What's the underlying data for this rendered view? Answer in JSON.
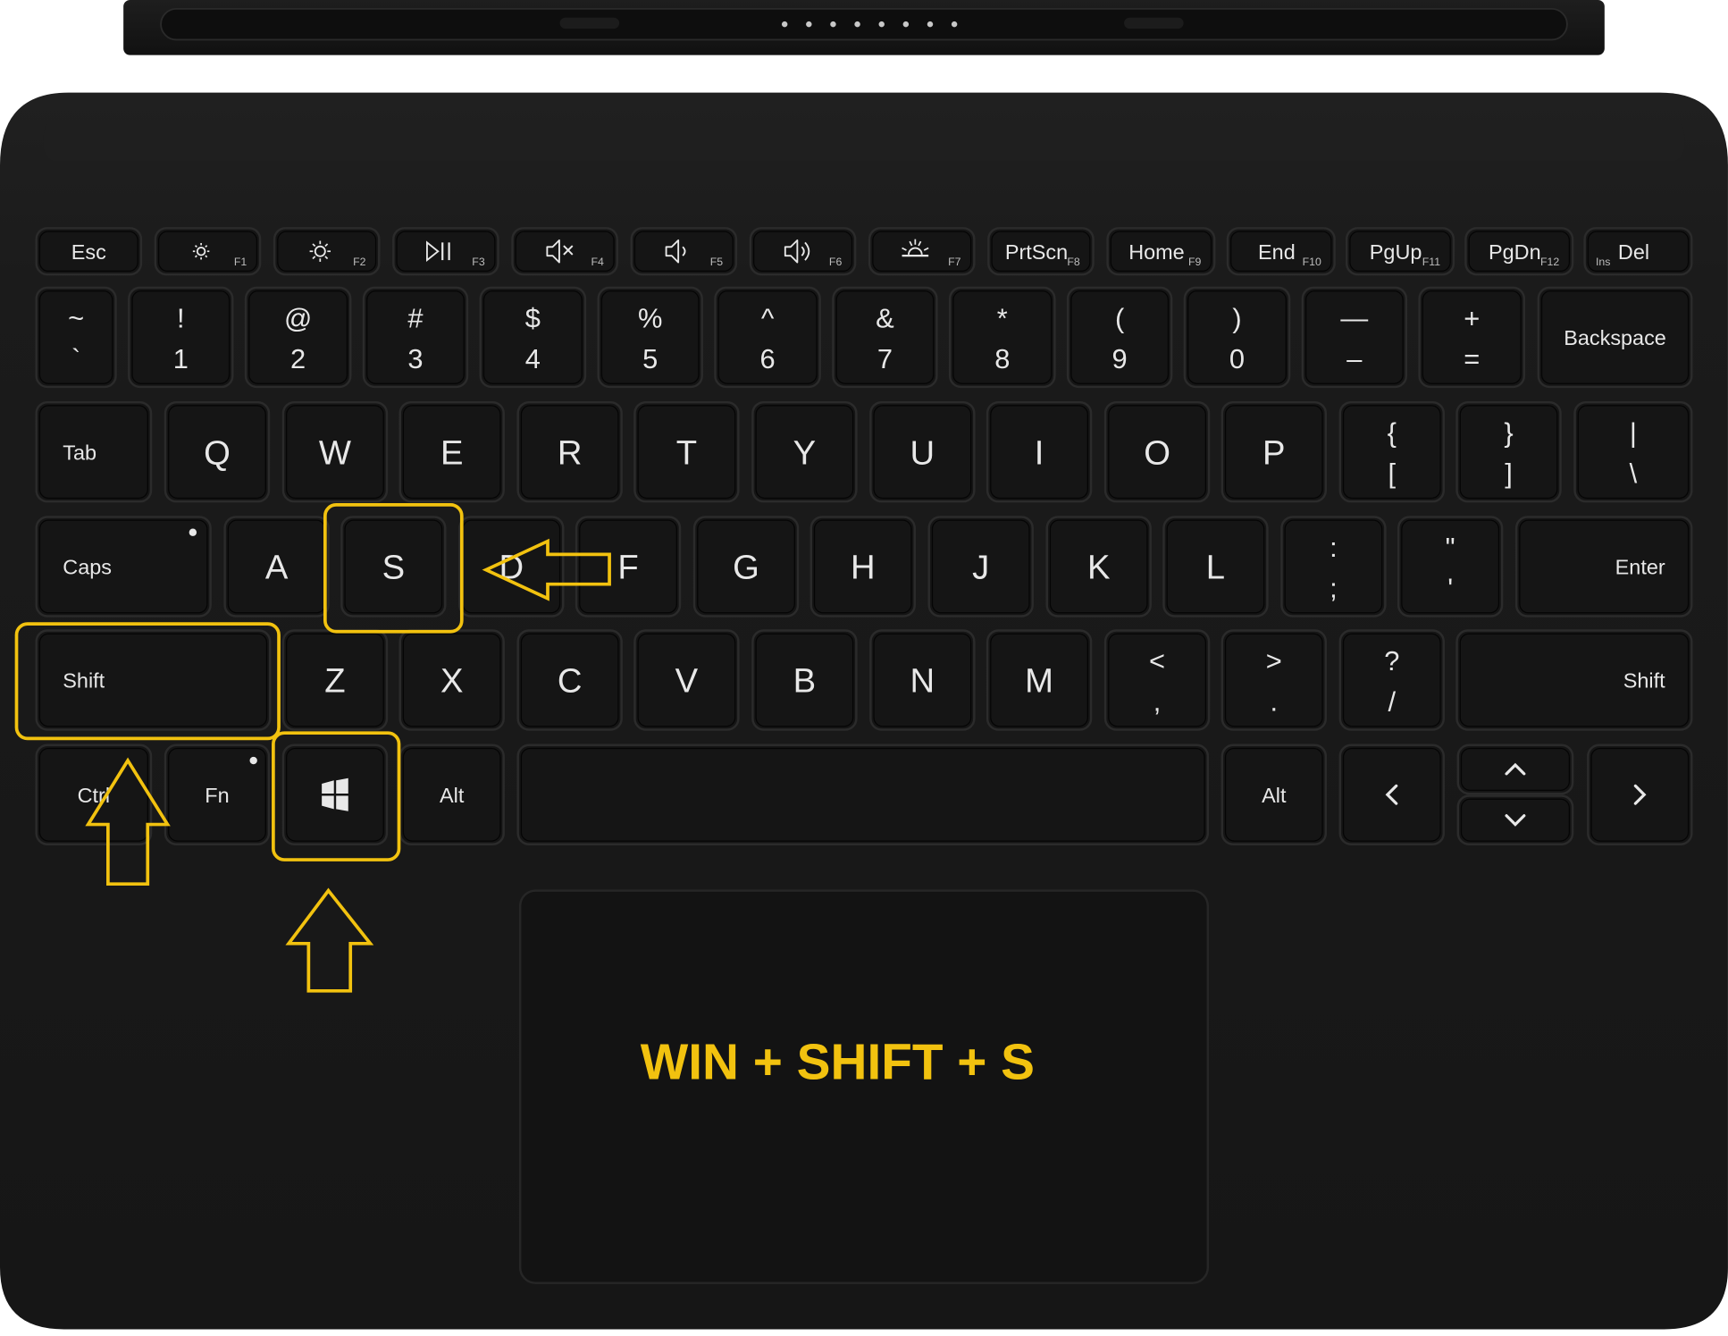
{
  "caption": "WIN + SHIFT + S",
  "colors": {
    "highlight": "#f2c20f",
    "keyboard_body": "#1a1a1a",
    "key_cap": "#151515",
    "key_label": "#e8e8e8"
  },
  "function_row": [
    {
      "label": "Esc",
      "sub": ""
    },
    {
      "icon": "brightness-down-icon",
      "sub": "F1"
    },
    {
      "icon": "brightness-up-icon",
      "sub": "F2"
    },
    {
      "icon": "play-pause-icon",
      "sub": "F3"
    },
    {
      "icon": "mute-icon",
      "sub": "F4"
    },
    {
      "icon": "volume-down-icon",
      "sub": "F5"
    },
    {
      "icon": "volume-up-icon",
      "sub": "F6"
    },
    {
      "icon": "keyboard-backlight-icon",
      "sub": "F7"
    },
    {
      "label": "PrtScn",
      "sub": "F8"
    },
    {
      "label": "Home",
      "sub": "F9"
    },
    {
      "label": "End",
      "sub": "F10"
    },
    {
      "label": "PgUp",
      "sub": "F11"
    },
    {
      "label": "PgDn",
      "sub": "F12"
    },
    {
      "label": "Del",
      "sub": "Ins"
    }
  ],
  "number_row": [
    {
      "top": "~",
      "bottom": "`"
    },
    {
      "top": "!",
      "bottom": "1"
    },
    {
      "top": "@",
      "bottom": "2"
    },
    {
      "top": "#",
      "bottom": "3"
    },
    {
      "top": "$",
      "bottom": "4"
    },
    {
      "top": "%",
      "bottom": "5"
    },
    {
      "top": "^",
      "bottom": "6"
    },
    {
      "top": "&",
      "bottom": "7"
    },
    {
      "top": "*",
      "bottom": "8"
    },
    {
      "top": "(",
      "bottom": "9"
    },
    {
      "top": ")",
      "bottom": "0"
    },
    {
      "top": "—",
      "bottom": "–"
    },
    {
      "top": "+",
      "bottom": "="
    },
    {
      "label": "Backspace"
    }
  ],
  "qwerty_row": [
    {
      "label": "Tab"
    },
    {
      "big": "Q"
    },
    {
      "big": "W"
    },
    {
      "big": "E"
    },
    {
      "big": "R"
    },
    {
      "big": "T"
    },
    {
      "big": "Y"
    },
    {
      "big": "U"
    },
    {
      "big": "I"
    },
    {
      "big": "O"
    },
    {
      "big": "P"
    },
    {
      "top": "{",
      "bottom": "["
    },
    {
      "top": "}",
      "bottom": "]"
    },
    {
      "top": "|",
      "bottom": "\\"
    }
  ],
  "home_row": [
    {
      "label": "Caps"
    },
    {
      "big": "A"
    },
    {
      "big": "S"
    },
    {
      "big": "D"
    },
    {
      "big": "F"
    },
    {
      "big": "G"
    },
    {
      "big": "H"
    },
    {
      "big": "J"
    },
    {
      "big": "K"
    },
    {
      "big": "L"
    },
    {
      "top": ":",
      "bottom": ";"
    },
    {
      "top": "\"",
      "bottom": "'"
    },
    {
      "label": "Enter"
    }
  ],
  "shift_row": [
    {
      "label": "Shift"
    },
    {
      "big": "Z"
    },
    {
      "big": "X"
    },
    {
      "big": "C"
    },
    {
      "big": "V"
    },
    {
      "big": "B"
    },
    {
      "big": "N"
    },
    {
      "big": "M"
    },
    {
      "top": "<",
      "bottom": ","
    },
    {
      "top": ">",
      "bottom": "."
    },
    {
      "top": "?",
      "bottom": "/"
    },
    {
      "label": "Shift"
    }
  ],
  "bottom_row": [
    {
      "label": "Ctrl"
    },
    {
      "label": "Fn"
    },
    {
      "icon": "windows-logo-icon"
    },
    {
      "label": "Alt"
    },
    {
      "label": ""
    },
    {
      "label": "Alt"
    },
    {
      "icon": "arrow-left-icon"
    },
    {
      "icon": "arrow-up-icon"
    },
    {
      "icon": "arrow-down-icon"
    },
    {
      "icon": "arrow-right-icon"
    }
  ]
}
